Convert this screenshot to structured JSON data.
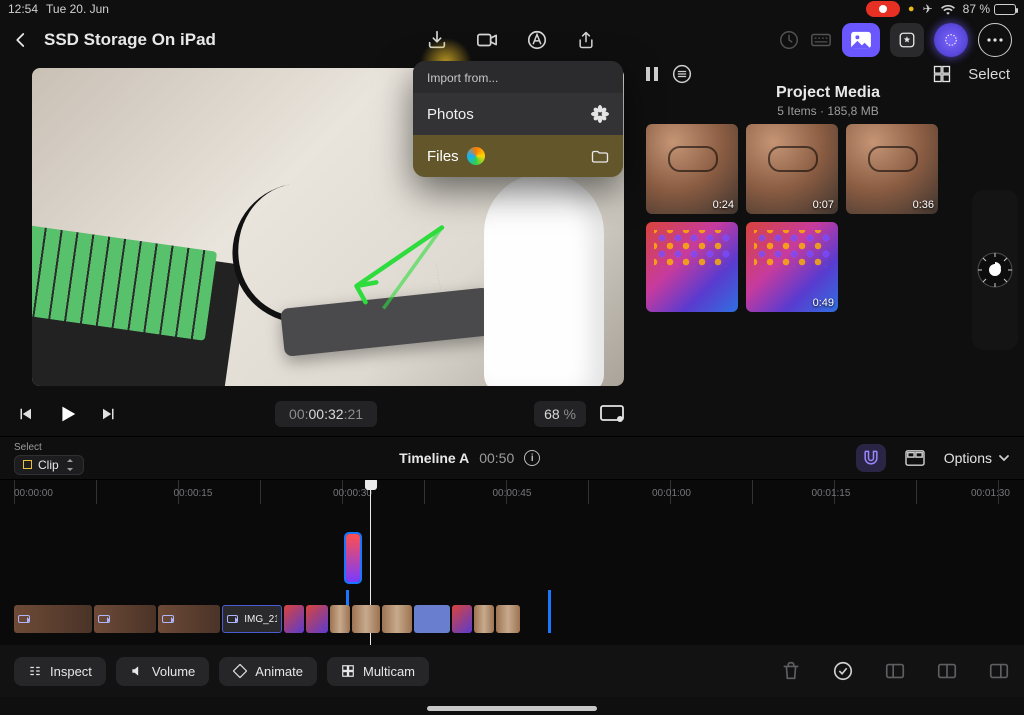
{
  "status": {
    "time": "12:54",
    "date": "Tue 20. Jun",
    "battery_pct": "87 %"
  },
  "title": "SSD Storage On iPad",
  "popover": {
    "header": "Import from...",
    "photos_label": "Photos",
    "files_label": "Files"
  },
  "media_panel": {
    "title": "Project Media",
    "subtitle_items": "5 Items",
    "subtitle_size": "185,8 MB",
    "select_label": "Select",
    "thumbs": [
      {
        "duration": "0:24"
      },
      {
        "duration": "0:07"
      },
      {
        "duration": "0:36"
      },
      {
        "duration": ""
      },
      {
        "duration": "0:49"
      }
    ]
  },
  "transport": {
    "timecode_gray": "00:",
    "timecode_white": "00:32",
    "timecode_frames": ":21",
    "zoom_value": "68",
    "zoom_unit": "%"
  },
  "timeline_header": {
    "select_label": "Select",
    "clip_label": "Clip",
    "name": "Timeline A",
    "duration": "00:50",
    "options_label": "Options"
  },
  "ruler_labels": [
    "00:00:00",
    "00:00:15",
    "00:00:30",
    "00:00:45",
    "00:01:00",
    "00:01:15",
    "00:01:30"
  ],
  "track_clip_label": "IMG_21",
  "bottom": {
    "inspect": "Inspect",
    "volume": "Volume",
    "animate": "Animate",
    "multicam": "Multicam"
  }
}
